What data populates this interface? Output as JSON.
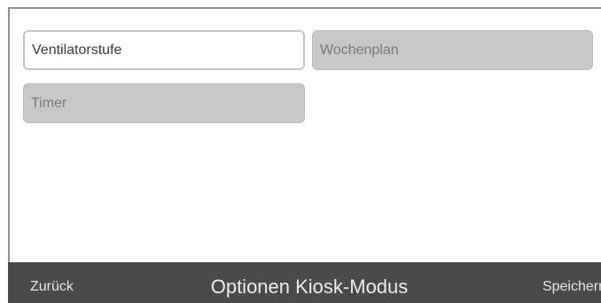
{
  "options": [
    {
      "label": "Ventilatorstufe",
      "selected": true
    },
    {
      "label": "Wochenplan",
      "selected": false
    },
    {
      "label": "Timer",
      "selected": false
    }
  ],
  "footer": {
    "back_label": "Zurück",
    "title": "Optionen Kiosk-Modus",
    "save_label": "Speichern"
  },
  "colors": {
    "footer_bg": "#4a4a4a",
    "option_inactive_bg": "#c8c8c8",
    "option_selected_border": "#c4c4c4"
  }
}
